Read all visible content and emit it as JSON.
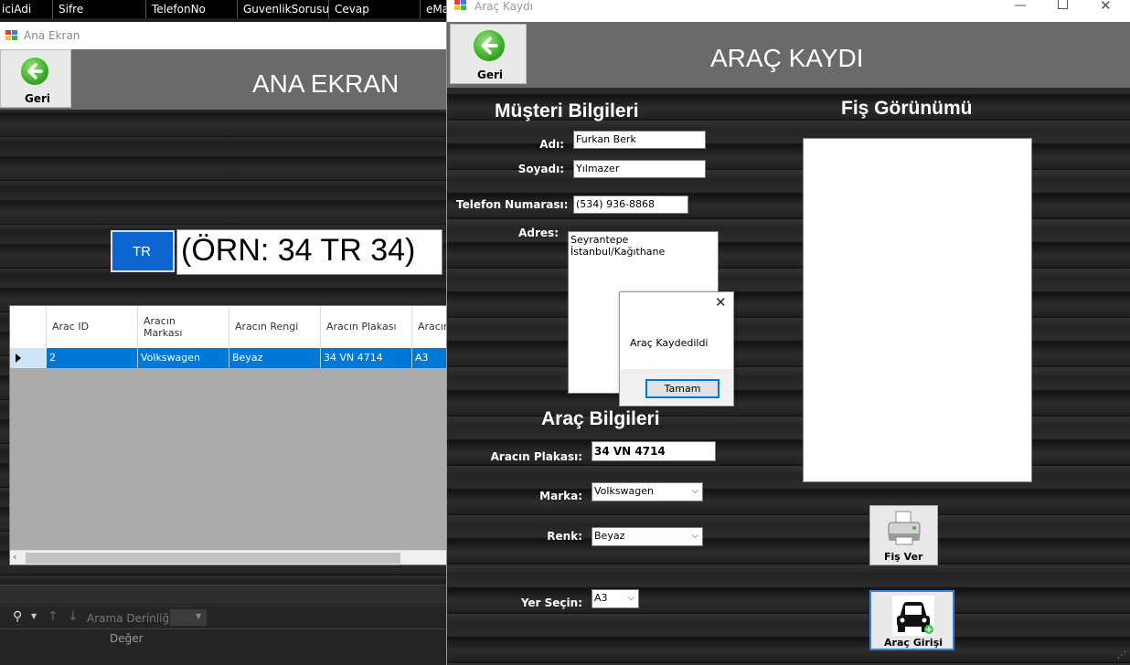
{
  "header_columns": [
    "iciAdi",
    "Sifre",
    "TelefonNo",
    "GuvenlikSorusu",
    "Cevap",
    "eMa"
  ],
  "ana_window": {
    "title": "Ana Ekran",
    "back_label": "Geri",
    "heading": "ANA EKRAN",
    "plate_prefix": "TR",
    "plate_example": "(ÖRN: 34 TR 34)",
    "grid": {
      "columns": [
        "Arac ID",
        "Aracın\nMarkası",
        "Aracın Rengi",
        "Aracın Plakası",
        "Aracın"
      ],
      "rows": [
        [
          "2",
          "Volkswagen",
          "Beyaz",
          "34 VN 4714",
          "A3"
        ]
      ]
    }
  },
  "bottom_toolbar": {
    "search_depth_label": "Arama Derinliği:",
    "value_label": "Değer"
  },
  "arac_window": {
    "title": "Araç Kaydı",
    "back_label": "Geri",
    "heading": "ARAÇ KAYDI",
    "musteri_section": "Müşteri Bilgileri",
    "fis_section": "Fiş Görünümü",
    "labels": {
      "adi": "Adı:",
      "soyadi": "Soyadı:",
      "telefon": "Telefon Numarası:",
      "adres": "Adres:",
      "plaka": "Aracın Plakası:",
      "marka": "Marka:",
      "renk": "Renk:",
      "yer": "Yer Seçin:"
    },
    "values": {
      "adi": "Furkan Berk",
      "soyadi": "Yılmazer",
      "telefon": "(534) 936-8868",
      "adres": "Seyrantepe İstanbul/Kağıthane",
      "plaka": "34 VN 4714",
      "marka": "Volkswagen",
      "renk": "Beyaz",
      "yer": "A3"
    },
    "arac_section": "Araç Bilgileri",
    "fis_ver_label": "Fiş Ver",
    "arac_giris_label": "Araç Girişi"
  },
  "message_box": {
    "text": "Araç Kaydedildi",
    "ok_label": "Tamam"
  },
  "colors": {
    "selection_blue": "#0078d7",
    "tr_blue": "#0c64d1",
    "header_gray": "#6a6a6a"
  }
}
